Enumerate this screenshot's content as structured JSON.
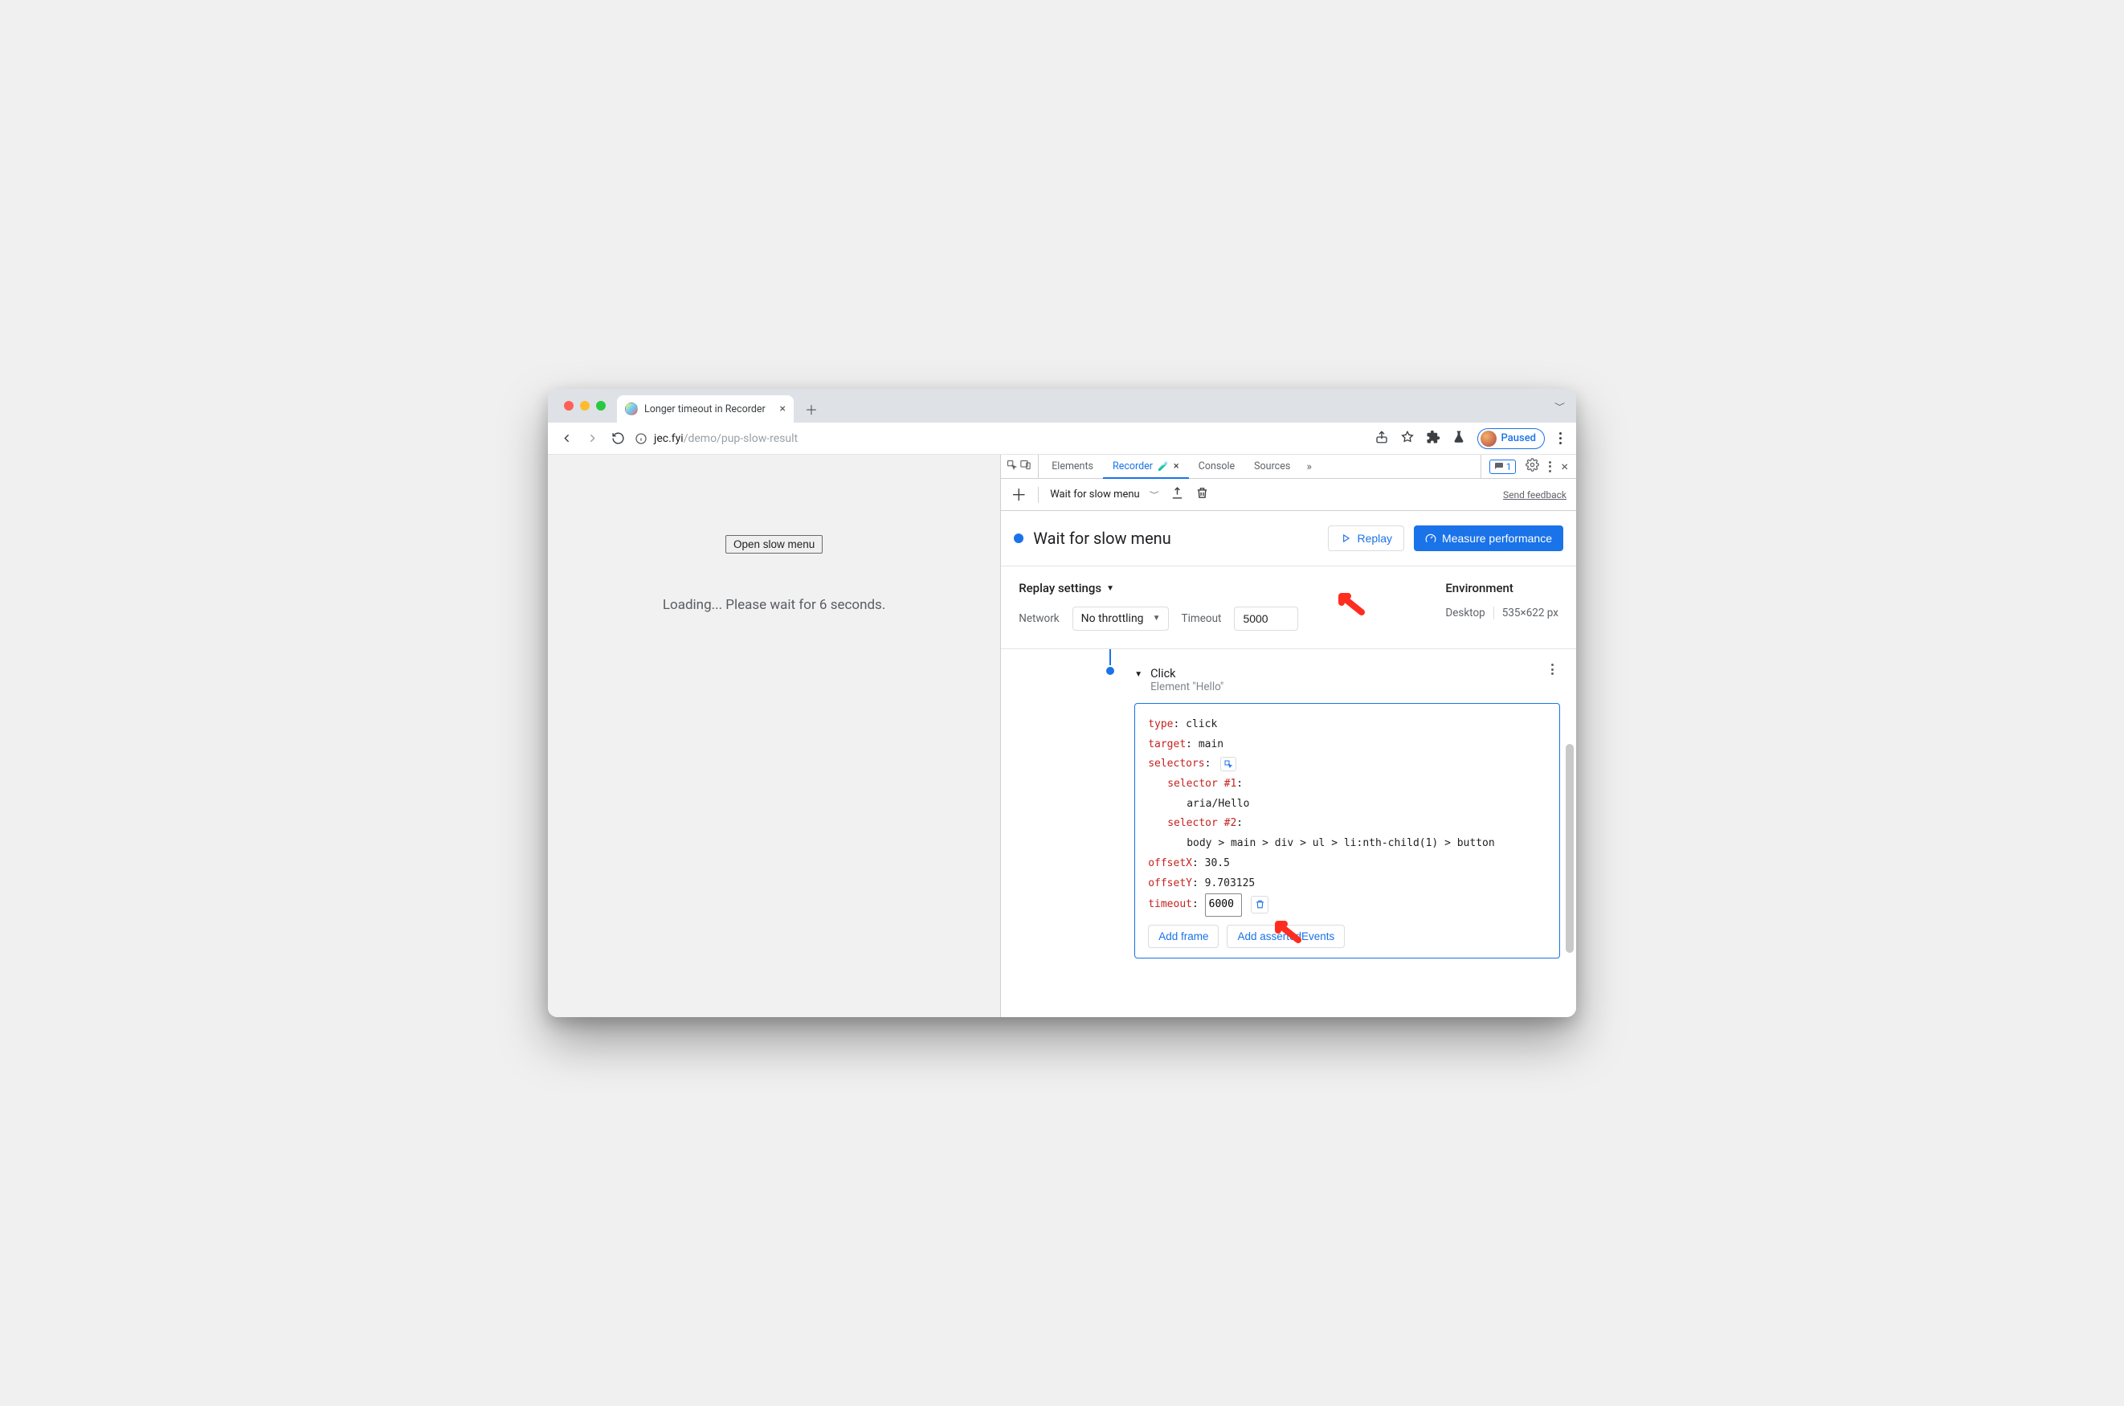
{
  "browser": {
    "tab": {
      "title": "Longer timeout in Recorder"
    },
    "url": {
      "host": "jec.fyi",
      "path": "/demo/pup-slow-result"
    },
    "paused_label": "Paused"
  },
  "page": {
    "open_button": "Open slow menu",
    "loading_text": "Loading... Please wait for 6 seconds."
  },
  "devtools": {
    "tabs": {
      "elements": "Elements",
      "recorder": "Recorder",
      "console": "Console",
      "sources": "Sources"
    },
    "msg_count": "1",
    "feedback": "Send feedback",
    "controls": {
      "recording_name": "Wait for slow menu"
    },
    "header": {
      "name": "Wait for slow menu",
      "replay": "Replay",
      "measure": "Measure performance"
    },
    "settings": {
      "title": "Replay settings",
      "network_label": "Network",
      "throttling": "No throttling",
      "timeout_label": "Timeout",
      "timeout_value": "5000",
      "env_title": "Environment",
      "env_device": "Desktop",
      "env_viewport": "535×622 px"
    },
    "step": {
      "title": "Click",
      "subtitle": "Element \"Hello\"",
      "fields": {
        "type_key": "type",
        "type_val": "click",
        "target_key": "target",
        "target_val": "main",
        "selectors_key": "selectors",
        "sel1_key": "selector #1",
        "sel1_val": "aria/Hello",
        "sel2_key": "selector #2",
        "sel2_val": "body > main > div > ul > li:nth-child(1) > button",
        "offx_key": "offsetX",
        "offx_val": "30.5",
        "offy_key": "offsetY",
        "offy_val": "9.703125",
        "timeout_key": "timeout",
        "timeout_val": "6000"
      },
      "actions": {
        "add_frame": "Add frame",
        "add_asserted": "Add assertedEvents"
      }
    }
  }
}
